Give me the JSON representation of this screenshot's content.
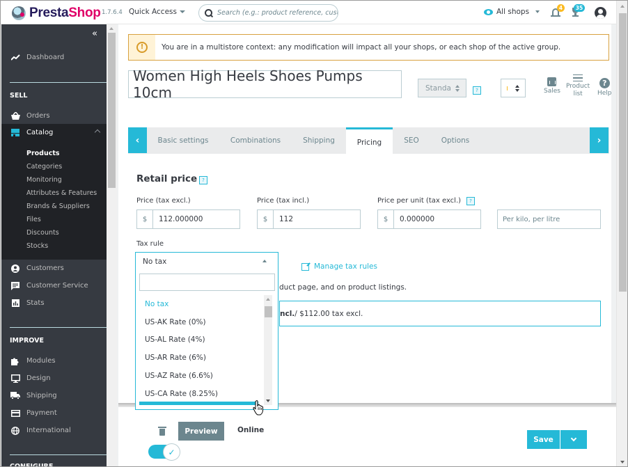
{
  "header": {
    "logo_part1": "Presta",
    "logo_part2": "Shop",
    "version": "1.7.6.4",
    "quick_access": "Quick Access",
    "search_placeholder": "Search (e.g.: product reference, custome",
    "shop_context": "All shops",
    "notifications_count": "4",
    "trophy_count": "35"
  },
  "sidebar": {
    "collapse_icon": "«",
    "dashboard": "Dashboard",
    "sections": {
      "sell": "SELL",
      "improve": "IMPROVE",
      "configure": "CONFIGURE"
    },
    "sell_items": [
      {
        "label": "Orders",
        "icon": "basket-icon"
      },
      {
        "label": "Catalog",
        "icon": "store-icon",
        "active": true
      },
      {
        "label": "Customers",
        "icon": "person-icon"
      },
      {
        "label": "Customer Service",
        "icon": "chat-icon"
      },
      {
        "label": "Stats",
        "icon": "chart-icon"
      }
    ],
    "catalog_sub": [
      "Products",
      "Categories",
      "Monitoring",
      "Attributes & Features",
      "Brands & Suppliers",
      "Files",
      "Discounts",
      "Stocks"
    ],
    "improve_items": [
      {
        "label": "Modules",
        "icon": "puzzle-icon"
      },
      {
        "label": "Design",
        "icon": "monitor-icon"
      },
      {
        "label": "Shipping",
        "icon": "truck-icon"
      },
      {
        "label": "Payment",
        "icon": "credit-card-icon"
      },
      {
        "label": "International",
        "icon": "globe-icon"
      }
    ]
  },
  "alert": {
    "text": "You are in a multistore context: any modification will impact all your shops, or each shop of the active group."
  },
  "product": {
    "name": "Women High Heels Shoes Pumps 10cm",
    "type_select": "Standa",
    "help": "?",
    "toolbar": {
      "sales": "Sales",
      "product_list_1": "Product",
      "product_list_2": "list",
      "help": "Help"
    }
  },
  "tabs": [
    {
      "label": "Basic settings"
    },
    {
      "label": "Combinations"
    },
    {
      "label": "Shipping"
    },
    {
      "label": "Pricing",
      "active": true
    },
    {
      "label": "SEO"
    },
    {
      "label": "Options"
    }
  ],
  "pricing": {
    "heading": "Retail price",
    "price_excl_label": "Price (tax excl.)",
    "price_excl_value": "112.000000",
    "price_incl_label": "Price (tax incl.)",
    "price_incl_value": "112",
    "unit_price_label": "Price per unit (tax excl.)",
    "unit_price_value": "0.000000",
    "unit_placeholder": "Per kilo, per litre",
    "currency": "$",
    "tax_rule_label": "Tax rule",
    "manage_tax_rules": "Manage tax rules",
    "description_partial": "duct page, and on product listings.",
    "summary_bold": "ncl.",
    "summary_rest": " / $112.00 tax excl."
  },
  "tax_dropdown": {
    "selected": "No tax",
    "search_value": "",
    "options": [
      "No tax",
      "US-AK Rate (0%)",
      "US-AL Rate (4%)",
      "US-AR Rate (6%)",
      "US-AZ Rate (6.6%)",
      "US-CA Rate (8.25%)"
    ]
  },
  "footer": {
    "preview": "Preview",
    "online": "Online",
    "online_enabled": true,
    "save": "Save"
  }
}
